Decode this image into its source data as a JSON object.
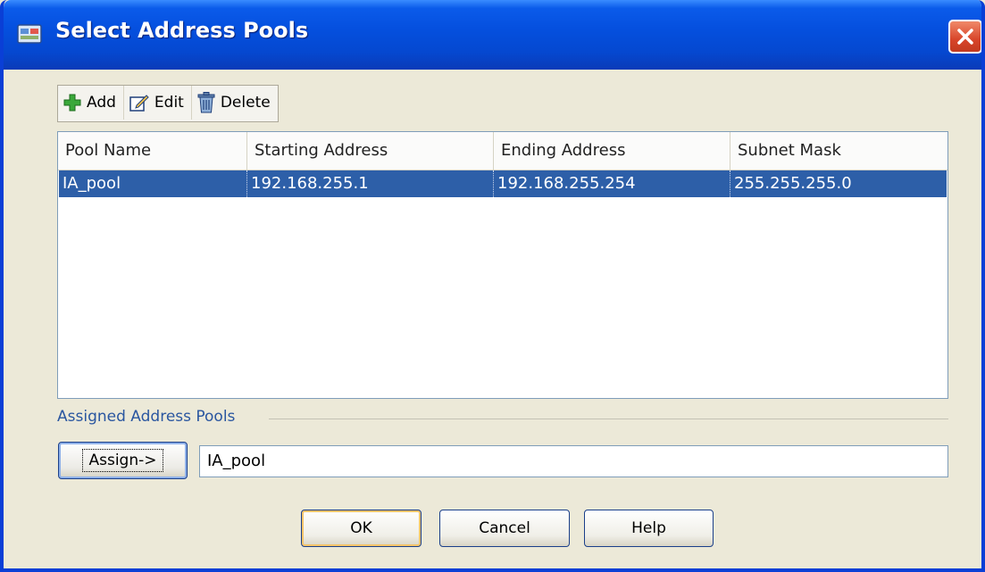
{
  "window": {
    "title": "Select Address Pools"
  },
  "toolbar": {
    "add_label": "Add",
    "edit_label": "Edit",
    "delete_label": "Delete"
  },
  "table": {
    "columns": [
      "Pool Name",
      "Starting Address",
      "Ending Address",
      "Subnet Mask"
    ],
    "rows": [
      [
        "IA_pool",
        "192.168.255.1",
        "192.168.255.254",
        "255.255.255.0"
      ]
    ],
    "selected_row": 0
  },
  "assigned": {
    "group_label": "Assigned Address Pools",
    "assign_button": "Assign->",
    "value": "IA_pool"
  },
  "buttons": {
    "ok": "OK",
    "cancel": "Cancel",
    "help": "Help"
  },
  "colors": {
    "title_bar": "#0550df",
    "selection": "#2d5fa8",
    "close": "#d8452a"
  },
  "icons": [
    "app-icon",
    "close-icon",
    "add-icon",
    "edit-icon",
    "delete-icon"
  ]
}
